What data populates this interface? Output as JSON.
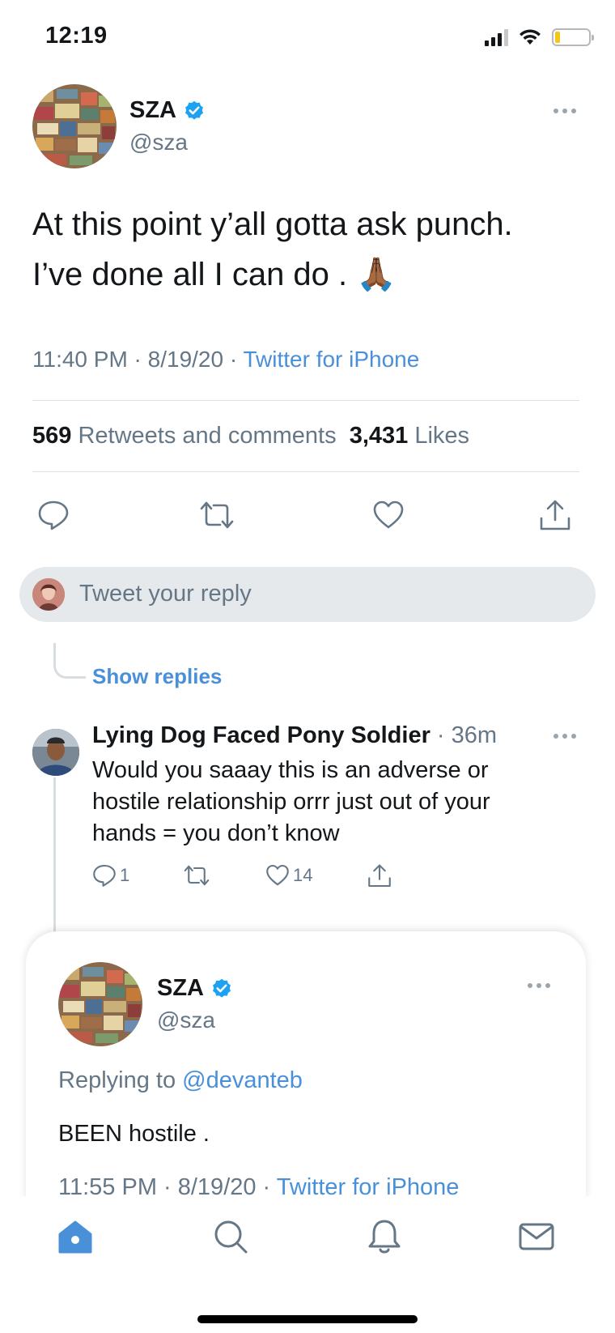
{
  "status_bar": {
    "time": "12:19"
  },
  "main_tweet": {
    "author_name": "SZA",
    "author_handle": "@sza",
    "text_line1": "At this point y’all gotta ask punch.",
    "text_line2": "I’ve done all I can do . 🙏🏾",
    "timestamp": "11:40 PM · 8/19/20 · ",
    "source": "Twitter for iPhone",
    "retweets_count": "569",
    "retweets_label": " Retweets and comments  ",
    "likes_count": "3,431",
    "likes_label": " Likes"
  },
  "reply_box": {
    "placeholder": "Tweet your reply"
  },
  "thread": {
    "show_replies": "Show replies"
  },
  "reply_tweet": {
    "author_name": "Lying Dog Faced Pony Soldier",
    "time": " · 36m",
    "text": "Would you saaay this is an adverse or hostile relationship orrr just out of your hands = you don’t know",
    "reply_count": "1",
    "like_count": "14"
  },
  "quoted_reply": {
    "author_name": "SZA",
    "author_handle": "@sza",
    "replying_to_label": "Replying to ",
    "mention": "@devanteb",
    "text": "BEEN hostile .",
    "timestamp": "11:55 PM · 8/19/20 · ",
    "source": "Twitter for iPhone"
  },
  "tab_bar": {
    "items": [
      "home-icon",
      "search-icon",
      "notifications-icon",
      "messages-icon"
    ],
    "active": "home-icon"
  },
  "colors": {
    "accent": "#4a90d9",
    "text": "#14171a",
    "muted": "#657786",
    "verified": "#1da1f2"
  }
}
